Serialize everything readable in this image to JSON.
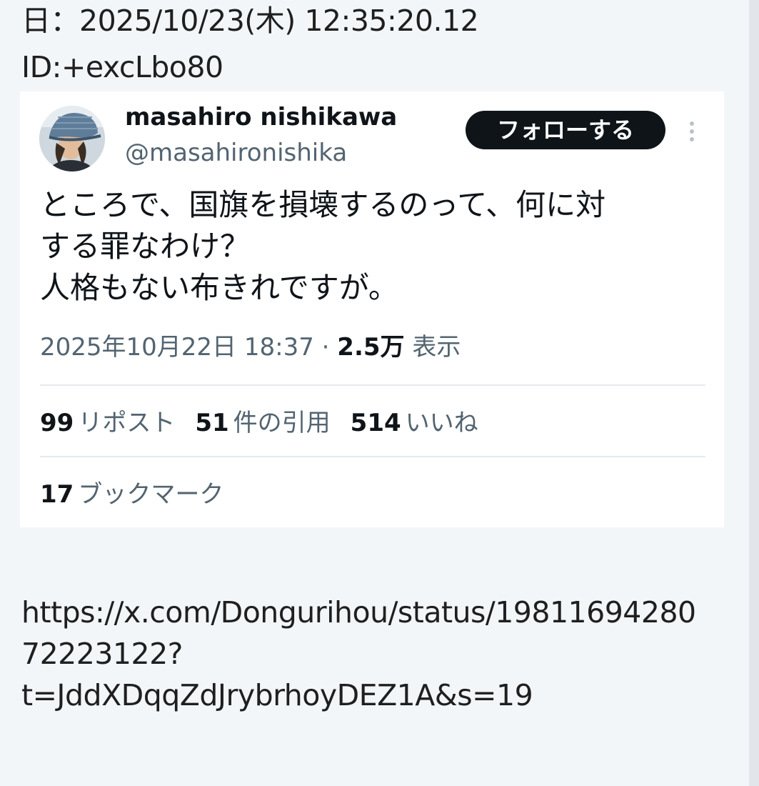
{
  "post": {
    "date_line": "日：2025/10/23(木) 12:35:20.12",
    "id_line": "ID:+excLbo80",
    "link_lines": [
      "https://x.com/Dongurihou/status/19811694280",
      "72223122?",
      "t=JddXDqqZdJrybrhoyDEZ1A&s=19"
    ]
  },
  "tweet": {
    "author_name": "masahiro nishikawa",
    "author_handle": "@masahironishika",
    "follow_label": "フォローする",
    "avatar_icon": "user-avatar-photo",
    "more_icon": "more-options-icon",
    "text": "ところで、国旗を損壊するのって、何に対\nする罪なわけ？\n人格もない布きれですが。",
    "timestamp": "2025年10月22日 18:37",
    "separator": " · ",
    "views_count": "2.5万",
    "views_label": " 表示",
    "stats": {
      "reposts_count": "99",
      "reposts_label": "リポスト",
      "quotes_count": "51",
      "quotes_label": "件の引用",
      "likes_count": "514",
      "likes_label": "いいね",
      "bookmarks_count": "17",
      "bookmarks_label": "ブックマーク"
    }
  },
  "colors": {
    "page_background": "#f3f6f9",
    "card_background": "#ffffff",
    "follow_button": "#0f1419",
    "secondary_text": "#536471"
  }
}
